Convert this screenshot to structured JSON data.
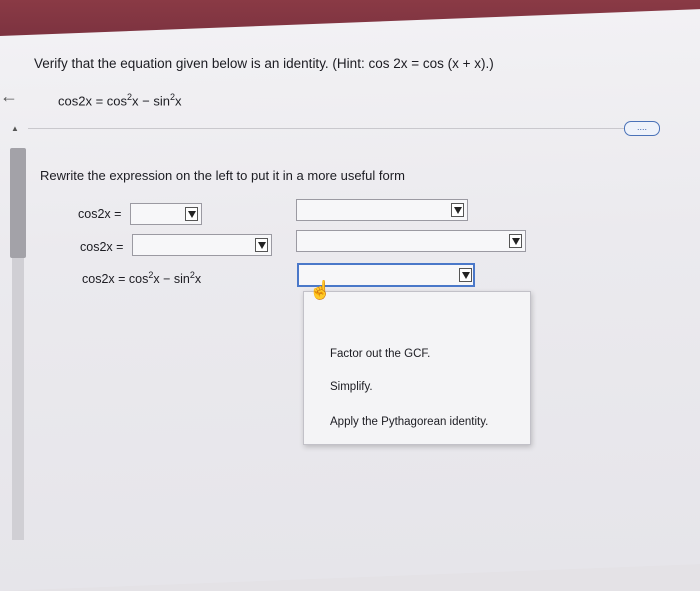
{
  "problem": {
    "prompt": "Verify that the equation given below is an identity. (Hint: cos 2x = cos (x + x).)",
    "equation": {
      "lhs": "cos2x",
      "eq": " = ",
      "t1": "cos",
      "t1_exp": "2",
      "t1_var": "x",
      "minus": " − ",
      "t2": "sin",
      "t2_exp": "2",
      "t2_var": "x"
    }
  },
  "more_button": "....",
  "rewrite_instruction": "Rewrite the expression on the left to put it in a more useful form",
  "rows": [
    {
      "label": "cos2x ="
    },
    {
      "label": "cos2x ="
    }
  ],
  "final_row": {
    "label": "cos2x = ",
    "t1": "cos",
    "t1_exp": "2",
    "t1_var": "x",
    "minus": " − ",
    "t2": "sin",
    "t2_exp": "2",
    "t2_var": "x"
  },
  "dropdown_menu": {
    "options": [
      "Factor out the GCF.",
      "Simplify.",
      "Apply the Pythagorean identity."
    ]
  },
  "colors": {
    "accent": "#4a78c9",
    "top_band": "#7d3340"
  }
}
